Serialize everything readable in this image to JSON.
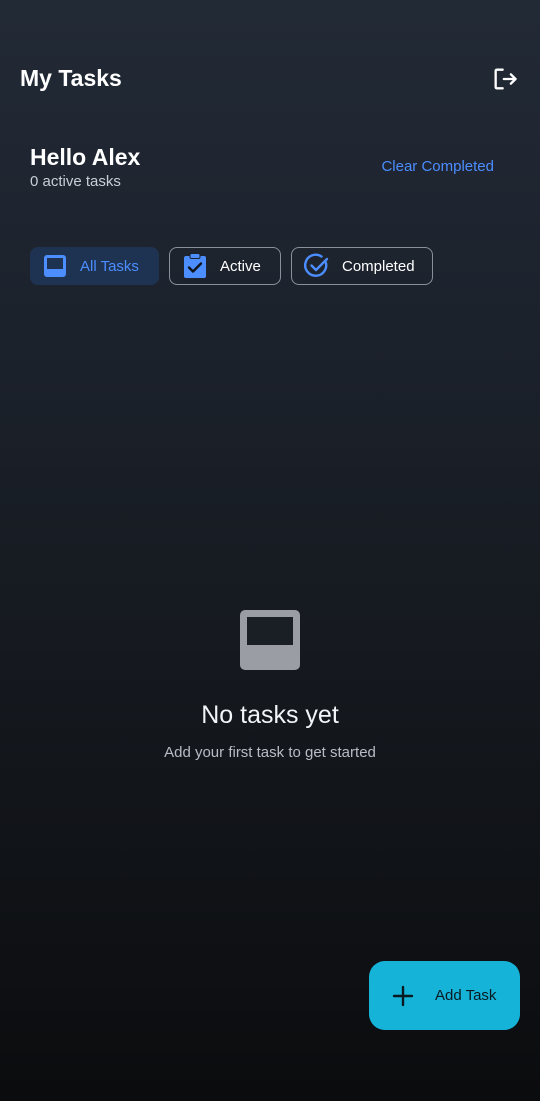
{
  "header": {
    "title": "My Tasks",
    "logout_icon": "logout-icon"
  },
  "greeting": {
    "title": "Hello Alex",
    "subtitle": "0 active tasks",
    "clear_completed_label": "Clear Completed"
  },
  "filters": [
    {
      "label": "All Tasks",
      "icon": "inbox-icon",
      "selected": true
    },
    {
      "label": "Active",
      "icon": "clipboard-check-icon",
      "selected": false
    },
    {
      "label": "Completed",
      "icon": "check-circle-icon",
      "selected": false
    }
  ],
  "empty_state": {
    "icon": "inbox-icon",
    "title": "No tasks yet",
    "subtitle": "Add your first task to get started"
  },
  "fab": {
    "label": "Add Task",
    "icon": "plus-icon"
  },
  "colors": {
    "accent": "#4c8dff",
    "fab": "#16b3d8",
    "selected_chip_bg": "#1e3352"
  }
}
